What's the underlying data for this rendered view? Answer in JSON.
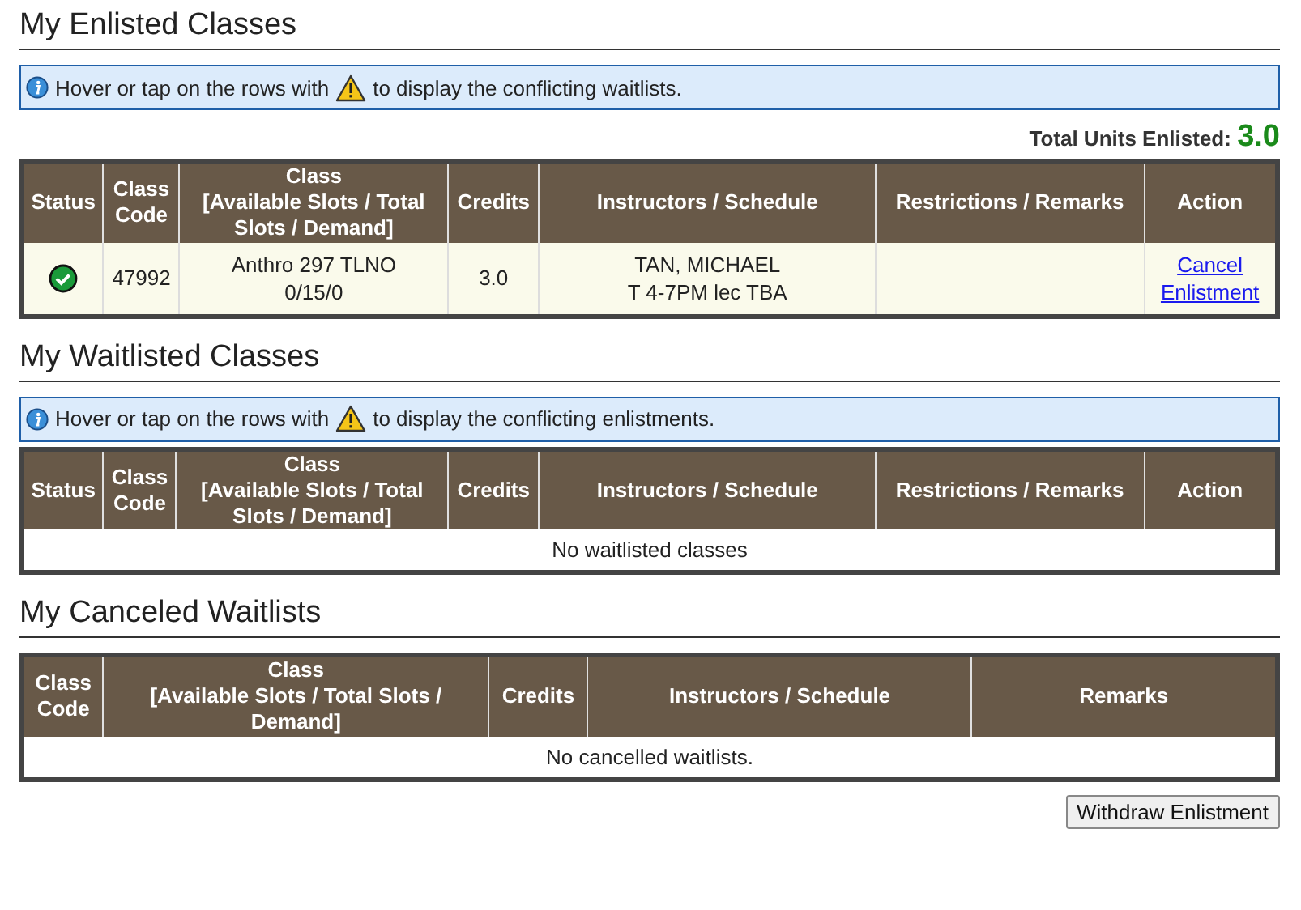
{
  "sections": [
    {
      "title": "My Enlisted Classes",
      "note": {
        "before": "Hover or tap on the rows with",
        "after": "to display the conflicting waitlists."
      },
      "total": {
        "label": "Total Units Enlisted:",
        "value": "3.0"
      },
      "columns": [
        "Status",
        "Class Code",
        "Class\n[Available Slots / Total Slots / Demand]",
        "Credits",
        "Instructors / Schedule",
        "Restrictions / Remarks",
        "Action"
      ],
      "rows": [
        {
          "enlisted": true,
          "code": "47992",
          "class": [
            "Anthro 297 TLNO",
            "0/15/0"
          ],
          "credits": "3.0",
          "instructors": [
            "TAN, MICHAEL",
            "T 4-7PM lec TBA"
          ],
          "action": [
            "Cancel",
            "Enlistment"
          ]
        }
      ]
    },
    {
      "title": "My Waitlisted Classes",
      "note": {
        "before": "Hover or tap on the rows with",
        "after": "to display the conflicting enlistments."
      },
      "columns": [
        "Status",
        "Class Code",
        "Class\n[Available Slots / Total Slots / Demand]",
        "Credits",
        "Instructors / Schedule",
        "Restrictions / Remarks",
        "Action"
      ],
      "empty": "No waitlisted classes"
    },
    {
      "title": "My Canceled Waitlists",
      "columns": [
        "Class Code",
        "Class\n[Available Slots / Total Slots / Demand]",
        "Credits",
        "Instructors / Schedule",
        "Remarks"
      ],
      "empty": "No cancelled waitlists."
    }
  ],
  "button": "Withdraw Enlistment"
}
